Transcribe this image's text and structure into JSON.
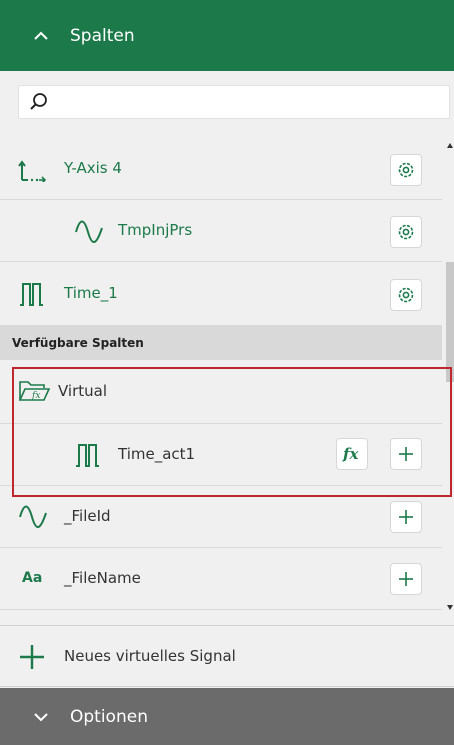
{
  "header": {
    "title": "Spalten"
  },
  "search": {
    "placeholder": "",
    "value": ""
  },
  "selected_columns": [
    {
      "label": "Y-Axis 4",
      "icon": "axis-icon",
      "action": "gear-icon"
    },
    {
      "label": "TmpInjPrs",
      "icon": "sine-wave-icon",
      "action": "gear-icon"
    },
    {
      "label": "Time_1",
      "icon": "square-wave-icon",
      "action": "gear-icon"
    }
  ],
  "available_section": {
    "title": "Verfügbare Spalten"
  },
  "available_columns": [
    {
      "label": "Virtual",
      "icon": "virtual-folder-icon"
    },
    {
      "label": "Time_act1",
      "icon": "square-wave-icon",
      "actions": [
        "fx-icon",
        "plus-icon"
      ]
    },
    {
      "label": "_FileId",
      "icon": "sine-wave-icon",
      "actions": [
        "plus-icon"
      ]
    },
    {
      "label": "_FileName",
      "icon": "text-aa-icon",
      "icon_text": "Aa",
      "actions": [
        "plus-icon"
      ]
    }
  ],
  "new_signal": {
    "label": "Neues virtuelles Signal"
  },
  "footer": {
    "title": "Optionen"
  },
  "colors": {
    "brand_green": "#1c7a4a",
    "footer_gray": "#6b6b6b",
    "highlight_red": "#c0262d"
  }
}
